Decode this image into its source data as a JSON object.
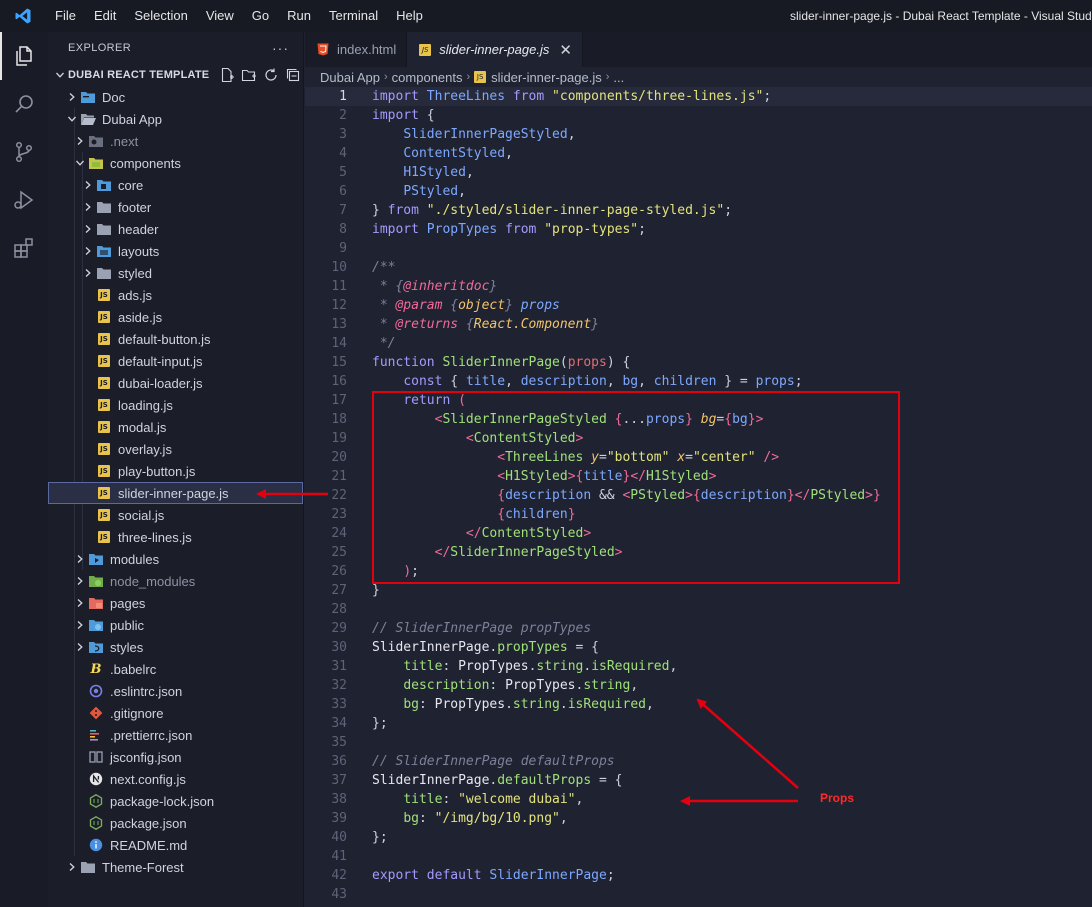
{
  "titlebar": {
    "menu": [
      "File",
      "Edit",
      "Selection",
      "View",
      "Go",
      "Run",
      "Terminal",
      "Help"
    ],
    "window_title": "slider-inner-page.js - Dubai React Template - Visual Studio"
  },
  "activitybar": {
    "icons": [
      "explorer-icon",
      "search-icon",
      "source-control-icon",
      "run-debug-icon",
      "extensions-icon"
    ]
  },
  "sidebar": {
    "header": "EXPLORER",
    "more": "···",
    "project": "DUBAI REACT TEMPLATE",
    "tree": [
      {
        "label": "Doc"
      },
      {
        "label": "Dubai App"
      },
      {
        "label": ".next"
      },
      {
        "label": "components"
      },
      {
        "label": "core"
      },
      {
        "label": "footer"
      },
      {
        "label": "header"
      },
      {
        "label": "layouts"
      },
      {
        "label": "styled"
      },
      {
        "label": "ads.js"
      },
      {
        "label": "aside.js"
      },
      {
        "label": "default-button.js"
      },
      {
        "label": "default-input.js"
      },
      {
        "label": "dubai-loader.js"
      },
      {
        "label": "loading.js"
      },
      {
        "label": "modal.js"
      },
      {
        "label": "overlay.js"
      },
      {
        "label": "play-button.js"
      },
      {
        "label": "slider-inner-page.js"
      },
      {
        "label": "social.js"
      },
      {
        "label": "three-lines.js"
      },
      {
        "label": "modules"
      },
      {
        "label": "node_modules"
      },
      {
        "label": "pages"
      },
      {
        "label": "public"
      },
      {
        "label": "styles"
      },
      {
        "label": ".babelrc"
      },
      {
        "label": ".eslintrc.json"
      },
      {
        "label": ".gitignore"
      },
      {
        "label": ".prettierrc.json"
      },
      {
        "label": "jsconfig.json"
      },
      {
        "label": "next.config.js"
      },
      {
        "label": "package-lock.json"
      },
      {
        "label": "package.json"
      },
      {
        "label": "README.md"
      },
      {
        "label": "Theme-Forest"
      }
    ]
  },
  "tabs": [
    {
      "label": "index.html"
    },
    {
      "label": "slider-inner-page.js",
      "close": "✕"
    }
  ],
  "breadcrumb": [
    "Dubai App",
    "components",
    "slider-inner-page.js",
    "..."
  ],
  "editor": {
    "line_numbers": [
      "1",
      "2",
      "3",
      "4",
      "5",
      "6",
      "7",
      "8",
      "9",
      "10",
      "11",
      "12",
      "13",
      "14",
      "15",
      "16",
      "17",
      "18",
      "19",
      "20",
      "21",
      "22",
      "23",
      "24",
      "25",
      "26",
      "27",
      "28",
      "29",
      "30",
      "31",
      "32",
      "33",
      "34",
      "35",
      "36",
      "37",
      "38",
      "39",
      "40",
      "41",
      "42",
      "43"
    ],
    "current_line": "22"
  },
  "annotation": {
    "label": "Props",
    "color": "#e3000f"
  }
}
